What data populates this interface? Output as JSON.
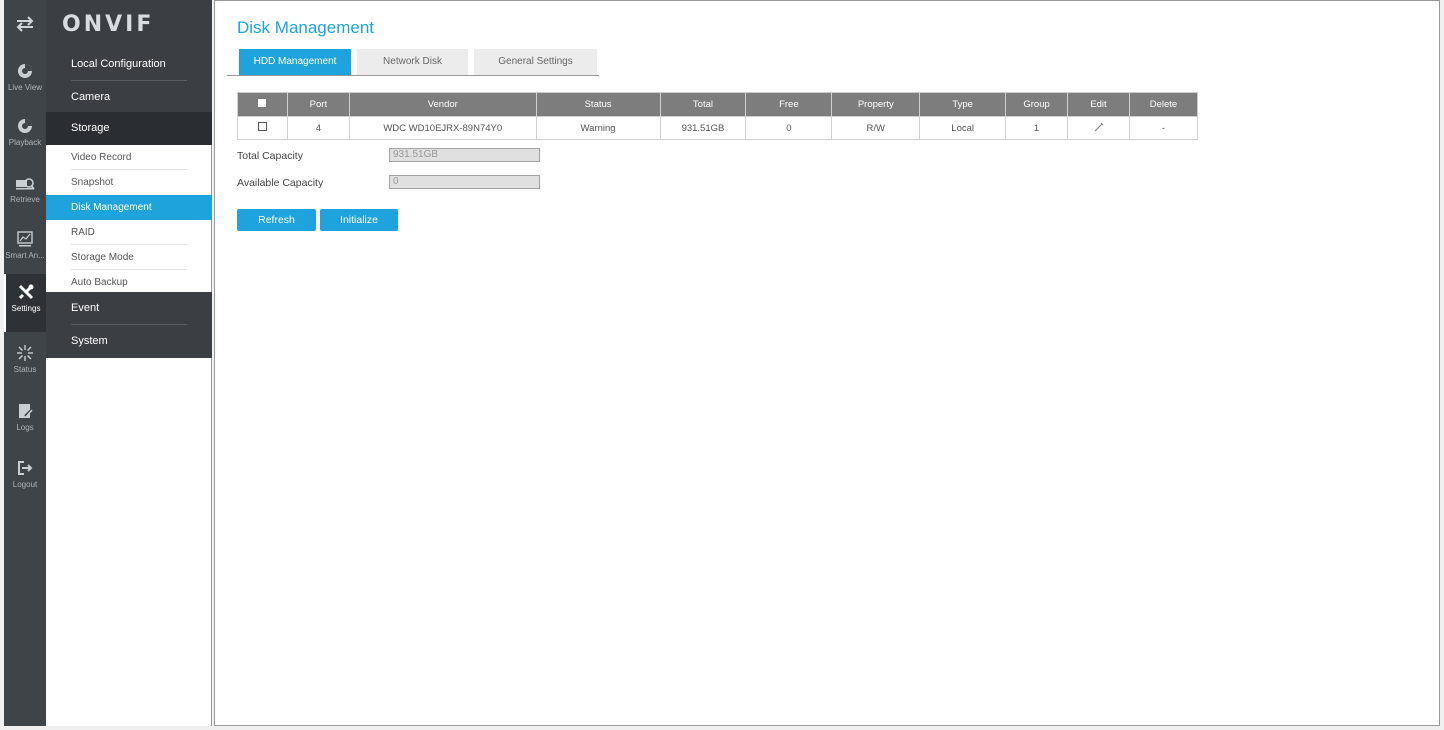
{
  "logo": "ONVIF",
  "rail": [
    {
      "label": "",
      "icon": "swap-arrows-icon"
    },
    {
      "label": "Live View",
      "icon": "live-view-icon"
    },
    {
      "label": "Playback",
      "icon": "playback-icon"
    },
    {
      "label": "Retrieve",
      "icon": "retrieve-icon"
    },
    {
      "label": "Smart An...",
      "icon": "smart-analysis-icon"
    },
    {
      "label": "Settings",
      "icon": "settings-tools-icon"
    },
    {
      "label": "Status",
      "icon": "status-icon"
    },
    {
      "label": "Logs",
      "icon": "logs-icon"
    },
    {
      "label": "Logout",
      "icon": "logout-icon"
    }
  ],
  "menu": {
    "local_configuration": "Local Configuration",
    "camera": "Camera",
    "storage": "Storage",
    "storage_items": [
      "Video Record",
      "Snapshot",
      "Disk Management",
      "RAID",
      "Storage Mode",
      "Auto Backup"
    ],
    "event": "Event",
    "system": "System"
  },
  "page": {
    "title": "Disk Management",
    "tabs": [
      "HDD Management",
      "Network Disk",
      "General Settings"
    ],
    "active_tab": "HDD Management"
  },
  "table": {
    "headers": [
      "Port",
      "Vendor",
      "Status",
      "Total",
      "Free",
      "Property",
      "Type",
      "Group",
      "Edit",
      "Delete"
    ],
    "rows": [
      {
        "port": "4",
        "vendor": "WDC WD10EJRX-89N74Y0",
        "status": "Warning",
        "total": "931.51GB",
        "free": "0",
        "property": "R/W",
        "type": "Local",
        "group": "1",
        "edit_icon": "pencil-icon",
        "delete": "-"
      }
    ]
  },
  "capacity": {
    "total_label": "Total Capacity",
    "total_value": "931.51GB",
    "available_label": "Available Capacity",
    "available_value": "0"
  },
  "buttons": {
    "refresh": "Refresh",
    "initialize": "Initialize"
  },
  "colors": {
    "accent": "#1ea3dd",
    "rail_bg": "#3f4449",
    "header_gray": "#7d7d7d"
  }
}
